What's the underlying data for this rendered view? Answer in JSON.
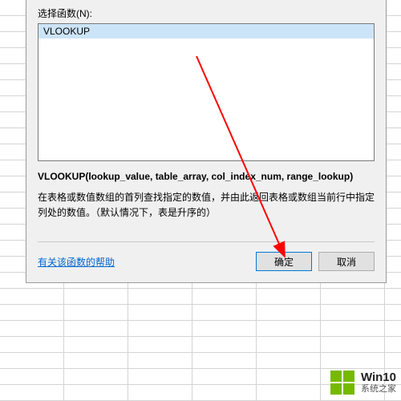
{
  "dialog": {
    "select_label": "选择函数(N):",
    "function_list": {
      "items": [
        "VLOOKUP"
      ],
      "selected": 0
    },
    "signature": "VLOOKUP(lookup_value, table_array, col_index_num, range_lookup)",
    "description": "在表格或数值数组的首列查找指定的数值，并由此返回表格或数组当前行中指定列处的数值。（默认情况下，表是升序的）",
    "help_link": "有关该函数的帮助",
    "ok_label": "确定",
    "cancel_label": "取消"
  },
  "watermark": {
    "line1": "Win10",
    "line2": "系统之家"
  }
}
